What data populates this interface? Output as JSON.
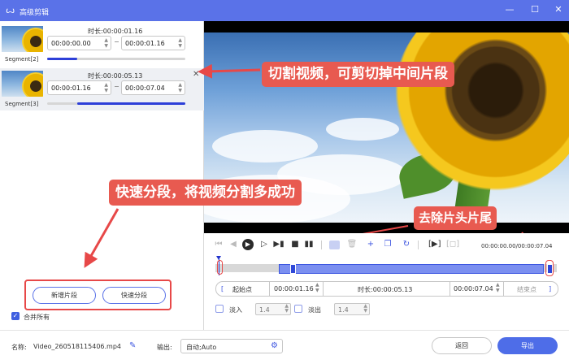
{
  "window": {
    "logo_glyph": "ꙍ",
    "title": "高级剪辑",
    "minimize_glyph": "—",
    "maximize_glyph": "☐",
    "close_glyph": "✕"
  },
  "segments": [
    {
      "name": "Segment[2]",
      "duration_label": "时长:",
      "duration": "00:00:01.16",
      "start": "00:00:00.00",
      "end": "00:00:01.16",
      "progress_start": 0.0,
      "progress_end": 0.22
    },
    {
      "name": "Segment[3]",
      "duration_label": "时长:",
      "duration": "00:00:05.13",
      "start": "00:00:01.16",
      "end": "00:00:07.04",
      "progress_start": 0.22,
      "progress_end": 1.0
    }
  ],
  "left_buttons": {
    "add_segment": "新增片段",
    "quick_split": "快速分段"
  },
  "merge_all": {
    "label": "合并所有",
    "checked": true
  },
  "callouts": {
    "cut": "切割视频，可剪切掉中间片段",
    "quick": "快速分段，将视频分割多成功",
    "trim": "去除片头片尾"
  },
  "player": {
    "time_display": "00:00:00.00/00:00:07.04"
  },
  "timeline": {
    "selection_start": 0.22,
    "selection_end": 1.0,
    "playhead": 0.0
  },
  "range": {
    "start_label": "起始点",
    "start_value": "00:00:01.16",
    "duration_label": "时长:00:00:05.13",
    "end_value": "00:00:07.04",
    "end_label": "结束点"
  },
  "fade": {
    "in_label": "淡入",
    "in_value": "1.4",
    "out_label": "淡出",
    "out_value": "1.4"
  },
  "footer": {
    "name_label": "名称:",
    "name_value": "Video_260518115406.mp4",
    "output_label": "输出:",
    "output_value": "自动;Auto",
    "back": "返回",
    "export": "导出"
  },
  "colors": {
    "accent": "#5a72e8",
    "callout": "#e85a50",
    "highlight": "#e74848"
  }
}
